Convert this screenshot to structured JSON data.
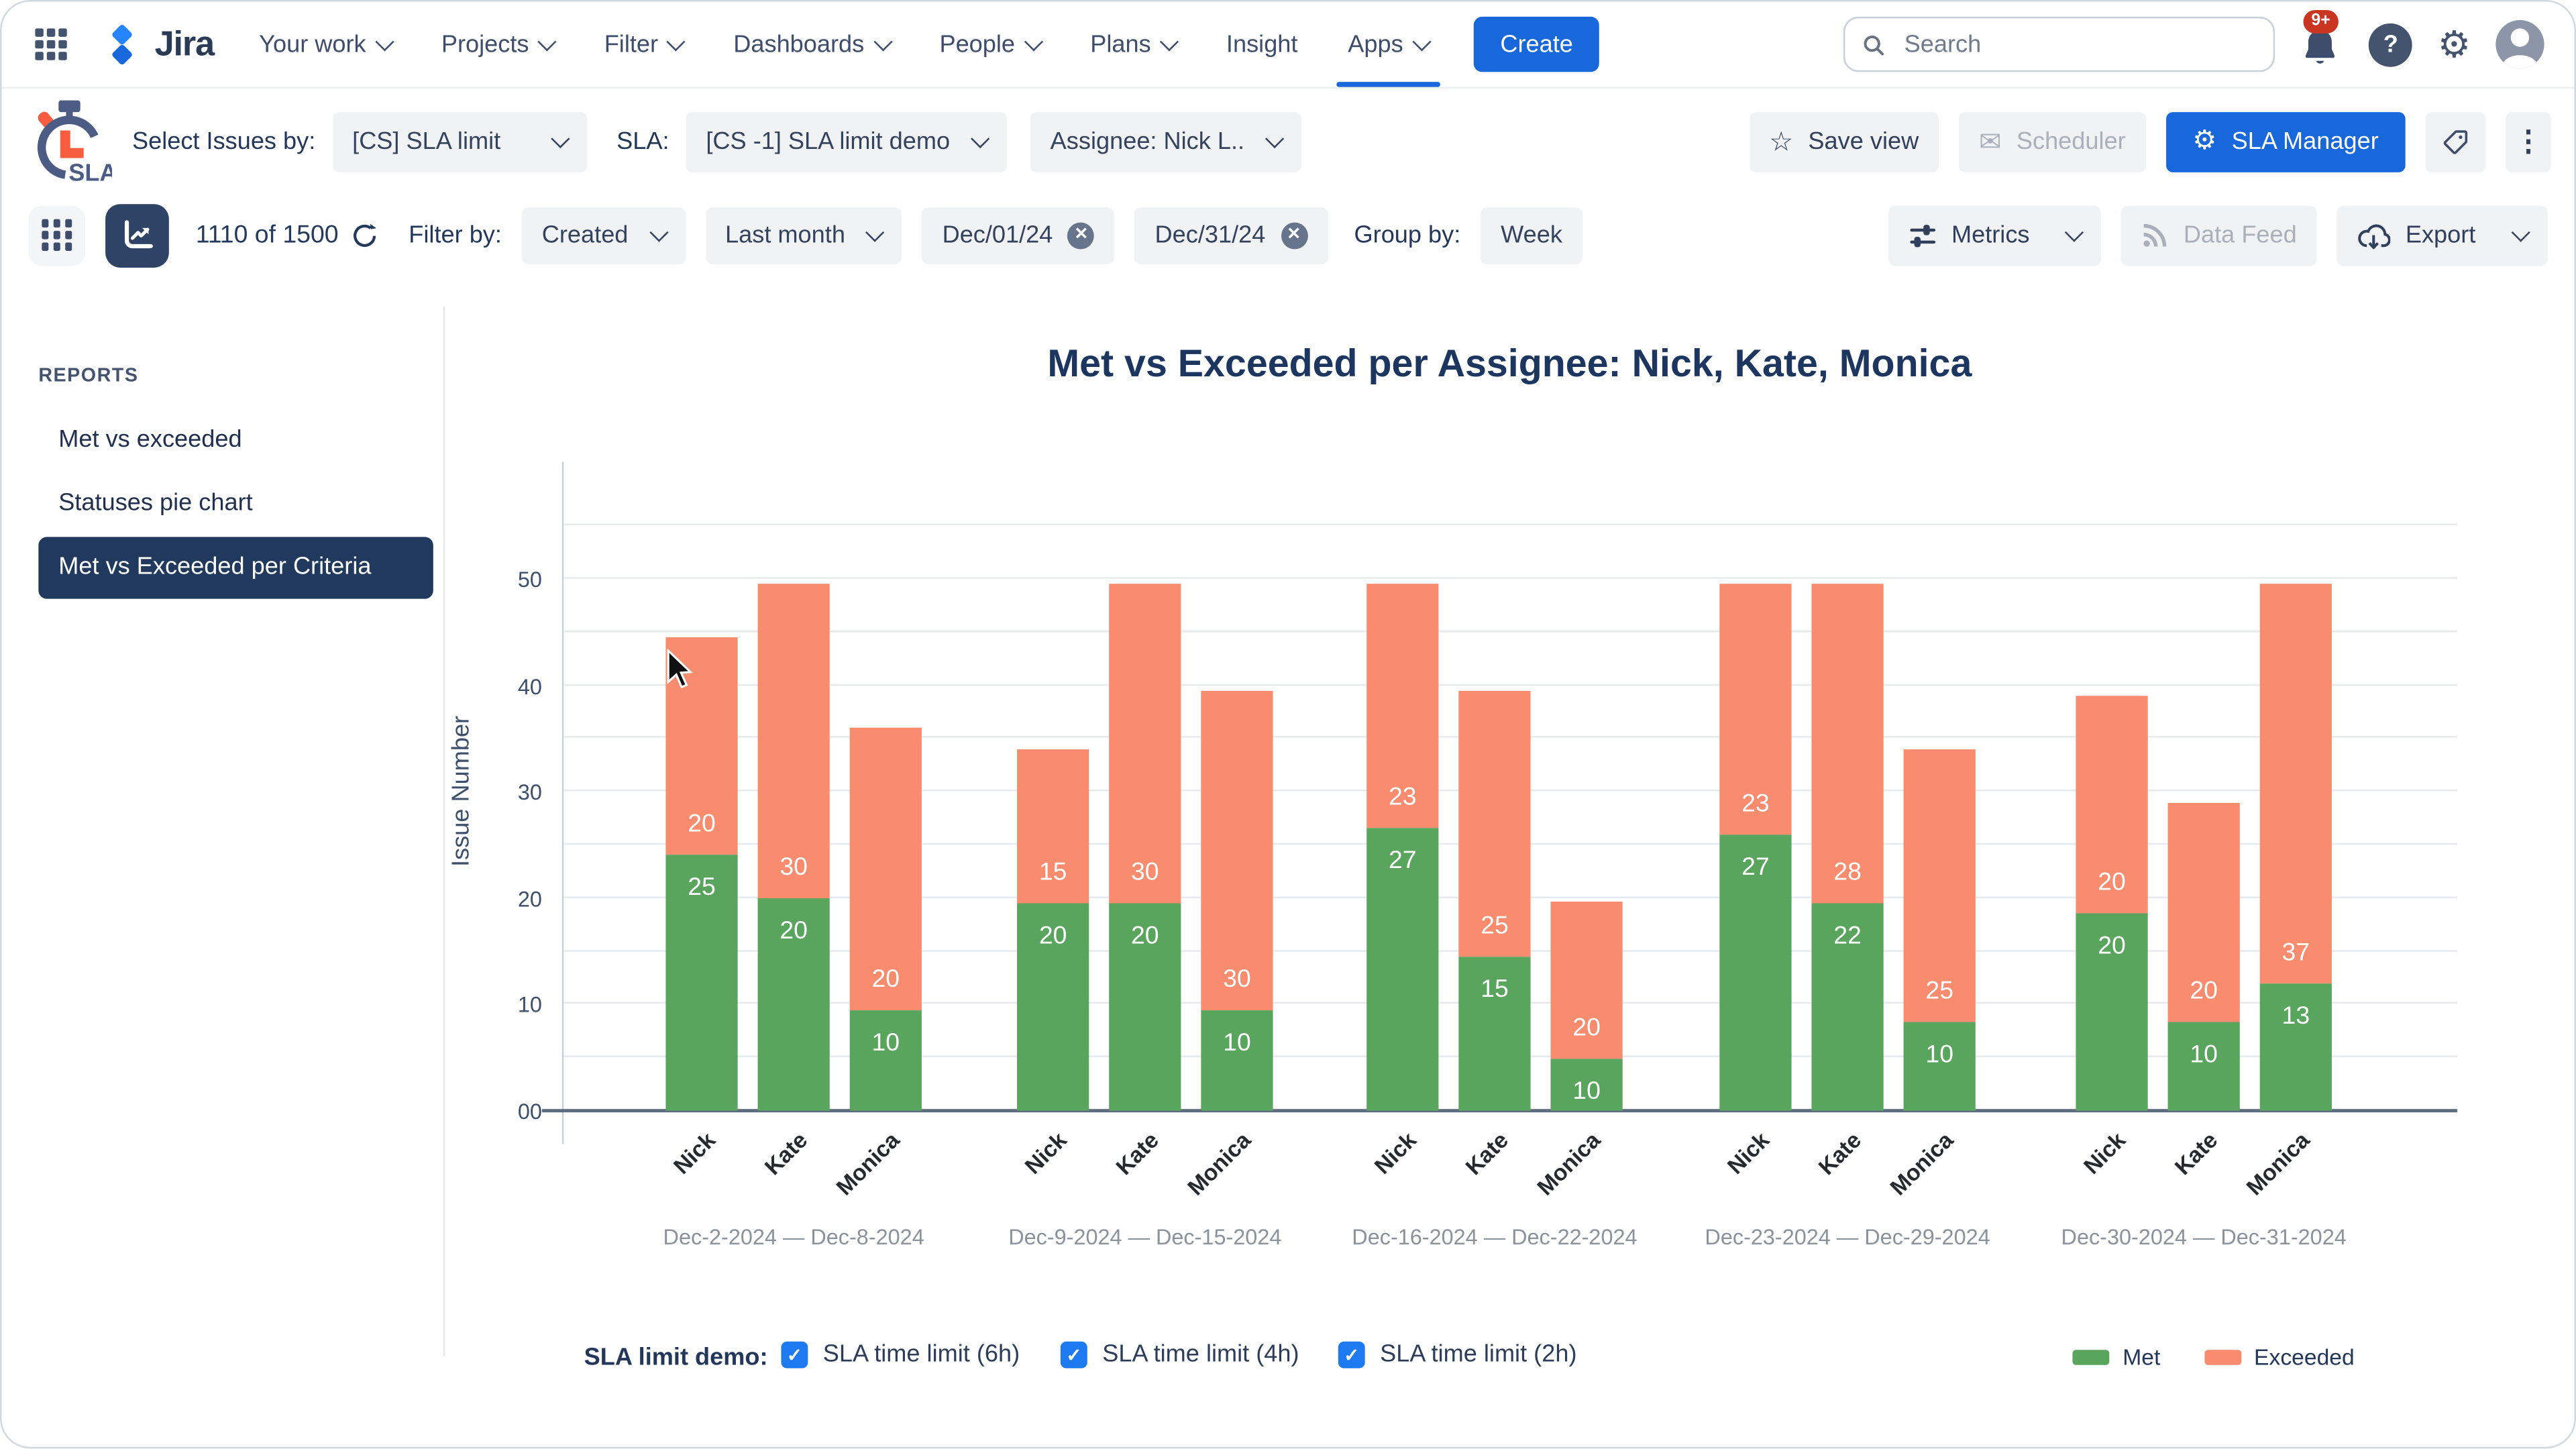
{
  "nav": {
    "logo_text": "Jira",
    "items": [
      {
        "label": "Your work",
        "dropdown": true
      },
      {
        "label": "Projects",
        "dropdown": true
      },
      {
        "label": "Filter",
        "dropdown": true
      },
      {
        "label": "Dashboards",
        "dropdown": true
      },
      {
        "label": "People",
        "dropdown": true
      },
      {
        "label": "Plans",
        "dropdown": true
      },
      {
        "label": "Insight",
        "dropdown": false
      },
      {
        "label": "Apps",
        "dropdown": true
      }
    ],
    "active_item": "Apps",
    "create_label": "Create",
    "search_placeholder": "Search",
    "notification_badge": "9+",
    "icons": [
      "app-switcher-grid",
      "search",
      "notification-bell",
      "help",
      "settings-gear",
      "avatar"
    ]
  },
  "toolbar_sla": {
    "logo_text": "SLA",
    "select_issues_label": "Select Issues by:",
    "select_issues_value": "[CS] SLA limit",
    "sla_label": "SLA:",
    "sla_value": "[CS -1] SLA limit demo",
    "assignee_value": "Assignee: Nick L..",
    "save_view_label": "Save view",
    "scheduler_label": "Scheduler",
    "sla_manager_label": "SLA Manager",
    "icons": [
      "stopwatch-logo",
      "star",
      "envelope",
      "gear",
      "tag",
      "kebab-menu"
    ]
  },
  "toolbar_filter": {
    "count": "1110 of 1500",
    "filter_by_label": "Filter by:",
    "filter_field_value": "Created",
    "filter_range_value": "Last month",
    "date_from": "Dec/01/24",
    "date_to": "Dec/31/24",
    "group_by_label": "Group by:",
    "group_by_value": "Week",
    "metrics_label": "Metrics",
    "data_feed_label": "Data Feed",
    "export_label": "Export",
    "icons": [
      "table-view",
      "chart-view",
      "refresh",
      "close-x",
      "sliders",
      "rss",
      "cloud-download"
    ]
  },
  "sidebar": {
    "heading": "REPORTS",
    "items": [
      {
        "label": "Met vs exceeded",
        "active": false
      },
      {
        "label": "Statuses pie chart",
        "active": false
      },
      {
        "label": "Met vs Exceeded per Criteria",
        "active": true
      }
    ]
  },
  "chart_data": {
    "type": "bar",
    "stacked": true,
    "title": "Met vs Exceeded per Assignee: Nick, Kate, Monica",
    "xlabel": "",
    "ylabel": "Issue Number",
    "yticks": [
      "00",
      "10",
      "20",
      "30",
      "40",
      "50"
    ],
    "ylim": [
      0,
      60
    ],
    "grid_step": 5,
    "grid": true,
    "legend_position": "bottom-right",
    "legend": [
      {
        "label": "Met",
        "color": "#5AA55E"
      },
      {
        "label": "Exceeded",
        "color": "#F98C6E"
      }
    ],
    "groups": [
      {
        "range": "Dec-2-2024 — Dec-8-2024",
        "bars": [
          {
            "name": "Nick",
            "met": 25,
            "exceeded": 20,
            "met_h": 24,
            "total_h": 44.5
          },
          {
            "name": "Kate",
            "met": 20,
            "exceeded": 30,
            "met_h": 20,
            "total_h": 49.5
          },
          {
            "name": "Monica",
            "met": 10,
            "exceeded": 20,
            "met_h": 9.5,
            "total_h": 36
          }
        ]
      },
      {
        "range": "Dec-9-2024 — Dec-15-2024",
        "bars": [
          {
            "name": "Nick",
            "met": 20,
            "exceeded": 15,
            "met_h": 19.5,
            "total_h": 34
          },
          {
            "name": "Kate",
            "met": 20,
            "exceeded": 30,
            "met_h": 19.5,
            "total_h": 49.5
          },
          {
            "name": "Monica",
            "met": 10,
            "exceeded": 30,
            "met_h": 9.5,
            "total_h": 39.5
          }
        ]
      },
      {
        "range": "Dec-16-2024 — Dec-22-2024",
        "bars": [
          {
            "name": "Nick",
            "met": 27,
            "exceeded": 23,
            "met_h": 26.5,
            "total_h": 49.5
          },
          {
            "name": "Kate",
            "met": 15,
            "exceeded": 25,
            "met_h": 14.5,
            "total_h": 39.5
          },
          {
            "name": "Monica",
            "met": 10,
            "exceeded": 20,
            "met_h": 4.8,
            "total_h": 19.6
          }
        ]
      },
      {
        "range": "Dec-23-2024 — Dec-29-2024",
        "bars": [
          {
            "name": "Nick",
            "met": 27,
            "exceeded": 23,
            "met_h": 26,
            "total_h": 49.5
          },
          {
            "name": "Kate",
            "met": 22,
            "exceeded": 28,
            "met_h": 19.5,
            "total_h": 49.5
          },
          {
            "name": "Monica",
            "met": 10,
            "exceeded": 25,
            "met_h": 8.3,
            "total_h": 34
          }
        ]
      },
      {
        "range": "Dec-30-2024 — Dec-31-2024",
        "bars": [
          {
            "name": "Nick",
            "met": 20,
            "exceeded": 20,
            "met_h": 18.5,
            "total_h": 39
          },
          {
            "name": "Kate",
            "met": 10,
            "exceeded": 20,
            "met_h": 8.3,
            "total_h": 29
          },
          {
            "name": "Monica",
            "met": 13,
            "exceeded": 37,
            "met_h": 12,
            "total_h": 49.5
          }
        ]
      }
    ]
  },
  "footer": {
    "prefix": "SLA limit demo:",
    "checkboxes": [
      "SLA time limit (6h)",
      "SLA time limit (4h)",
      "SLA time limit (2h)"
    ],
    "all_checked": true
  },
  "colors": {
    "accent_blue": "#1868DB",
    "checkbox_blue": "#1D7AF0",
    "met_green": "#5AA55E",
    "exceeded_salmon": "#F98C6E",
    "navy_text": "#22375A",
    "active_navy": "#21395D",
    "badge_red": "#CA3521"
  }
}
